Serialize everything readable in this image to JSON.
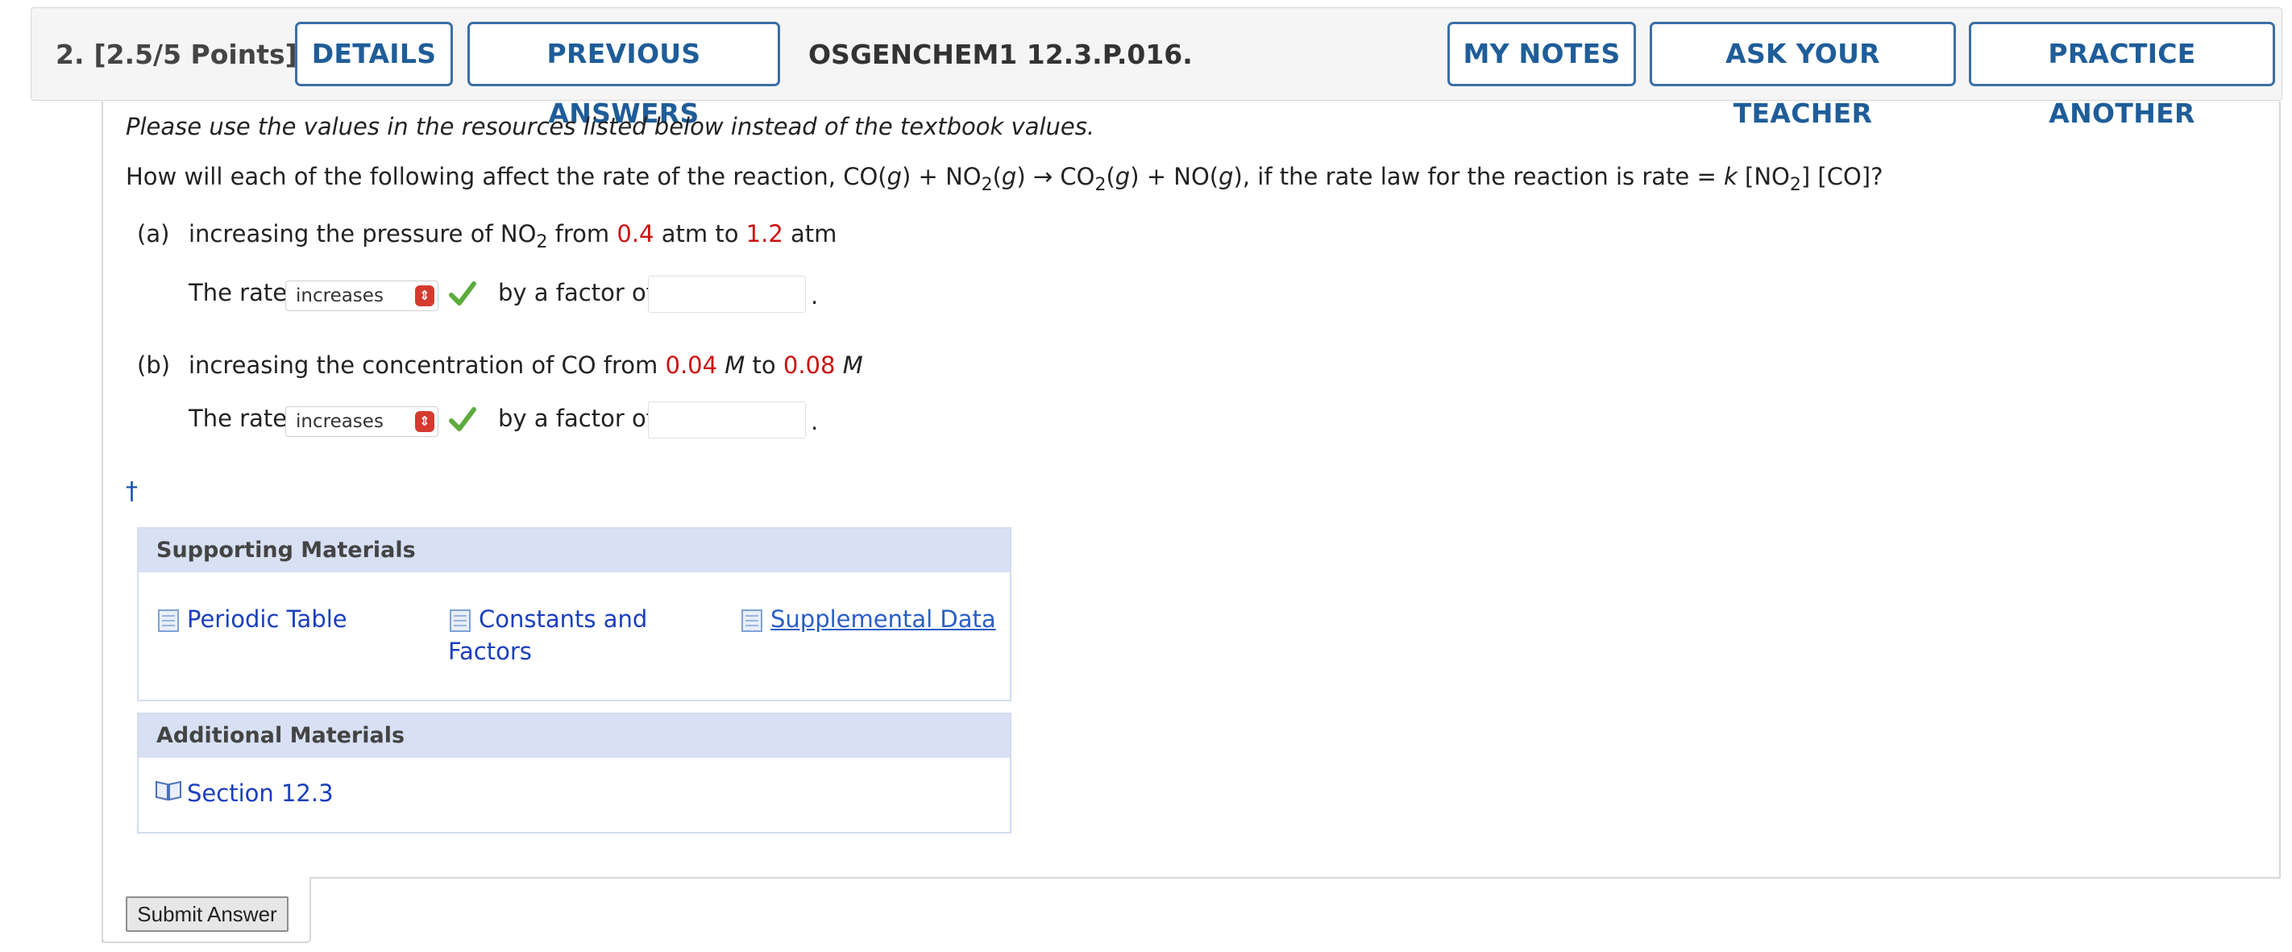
{
  "header": {
    "question_number": "2.",
    "points": "[2.5/5 Points]",
    "details_label": "DETAILS",
    "previous_answers_label": "PREVIOUS ANSWERS",
    "question_code": "OSGENCHEM1 12.3.P.016.",
    "my_notes_label": "MY NOTES",
    "ask_teacher_label": "ASK YOUR TEACHER",
    "practice_another_label": "PRACTICE ANOTHER"
  },
  "question": {
    "instruction": "Please use the values in the resources listed below instead of the textbook values.",
    "prompt": {
      "p1": "How will each of the following affect the rate of the reaction, CO(",
      "g": "g",
      "p2": ") + NO",
      "sub2": "2",
      "p3": "(",
      "p4": ") → CO",
      "p5": "(",
      "p6": ") + NO(",
      "p7": "), if the rate law for the reaction is rate = ",
      "k": "k",
      "p8": " [NO",
      "p9": "] [CO]?"
    },
    "part_a": {
      "label": "(a)",
      "text1": "increasing the pressure of NO",
      "sub": "2",
      "text2": " from ",
      "value1": "0.4",
      "text3": " atm to ",
      "value2": "1.2",
      "text4": " atm",
      "rate_label": "The rate",
      "selected": "increases",
      "factor_label": "by a factor of",
      "factor_value": "",
      "period": "."
    },
    "part_b": {
      "label": "(b)",
      "text1": "increasing the concentration of CO from ",
      "value1": "0.04",
      "unit": "M",
      "text2": " to ",
      "value2": "0.08",
      "rate_label": "The rate",
      "selected": "increases",
      "factor_label": "by a factor of",
      "factor_value": "",
      "period": "."
    },
    "dagger": "†"
  },
  "supporting_materials": {
    "title": "Supporting Materials",
    "items": [
      "Periodic Table",
      "Constants and",
      "Factors",
      "Supplemental Data"
    ]
  },
  "additional_materials": {
    "title": "Additional Materials",
    "items": [
      "Section 12.3"
    ]
  },
  "submit_label": "Submit Answer",
  "colors": {
    "button_border": "#3b6ea5",
    "button_text": "#1f5d99",
    "red_value": "#cc1111",
    "link": "#1a3fbd",
    "materials_header": "#d8e0f4"
  },
  "icons": [
    "check-icon",
    "select-arrow-icon",
    "document-icon",
    "book-icon"
  ]
}
